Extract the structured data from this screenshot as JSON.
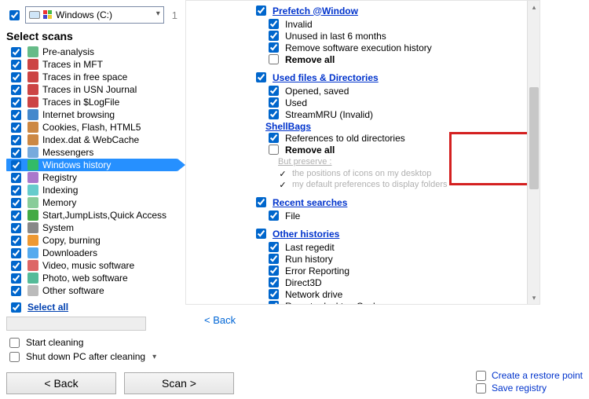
{
  "drive": {
    "label": "Windows (C:)",
    "count": "1"
  },
  "scans_title": "Select scans",
  "scans": [
    {
      "label": "Pre-analysis",
      "sel": false
    },
    {
      "label": "Traces in MFT",
      "sel": false
    },
    {
      "label": "Traces in free space",
      "sel": false
    },
    {
      "label": "Traces in USN Journal",
      "sel": false
    },
    {
      "label": "Traces in $LogFile",
      "sel": false
    },
    {
      "label": "Internet browsing",
      "sel": false
    },
    {
      "label": "Cookies, Flash, HTML5",
      "sel": false
    },
    {
      "label": "Index.dat & WebCache",
      "sel": false
    },
    {
      "label": "Messengers",
      "sel": false
    },
    {
      "label": "Windows history",
      "sel": true
    },
    {
      "label": "Registry",
      "sel": false
    },
    {
      "label": "Indexing",
      "sel": false
    },
    {
      "label": "Memory",
      "sel": false
    },
    {
      "label": "Start,JumpLists,Quick Access",
      "sel": false
    },
    {
      "label": "System",
      "sel": false
    },
    {
      "label": "Copy, burning",
      "sel": false
    },
    {
      "label": "Downloaders",
      "sel": false
    },
    {
      "label": "Video, music software",
      "sel": false
    },
    {
      "label": "Photo, web software",
      "sel": false
    },
    {
      "label": "Other software",
      "sel": false
    }
  ],
  "select_all": "Select all",
  "start_cleaning": "Start cleaning",
  "shutdown": "Shut down PC after cleaning",
  "buttons": {
    "back": "< Back",
    "scan": "Scan >"
  },
  "groups": {
    "prefetch": {
      "title": "Prefetch @Window",
      "items": [
        "Invalid",
        "Unused in last 6 months",
        "Remove software execution history"
      ],
      "remove_all": "Remove all"
    },
    "usedfiles": {
      "title": "Used files & Directories",
      "items": [
        "Opened, saved",
        "Used",
        "StreamMRU (Invalid)"
      ],
      "shellbags": "ShellBags",
      "refs": "References to old directories",
      "remove_all": "Remove all",
      "preserve_hdr": "But preserve :",
      "preserve1": "the positions of icons on my desktop",
      "preserve2": "my default preferences to display folders"
    },
    "recent": {
      "title": "Recent searches",
      "items": [
        "File"
      ]
    },
    "other": {
      "title": "Other histories",
      "items": [
        "Last regedit",
        "Run history",
        "Error Reporting",
        "Direct3D",
        "Network drive",
        "Remote desktop Cache"
      ]
    }
  },
  "back_link": "<  Back",
  "footer": {
    "restore": "Create a restore point",
    "savereg": "Save registry"
  }
}
